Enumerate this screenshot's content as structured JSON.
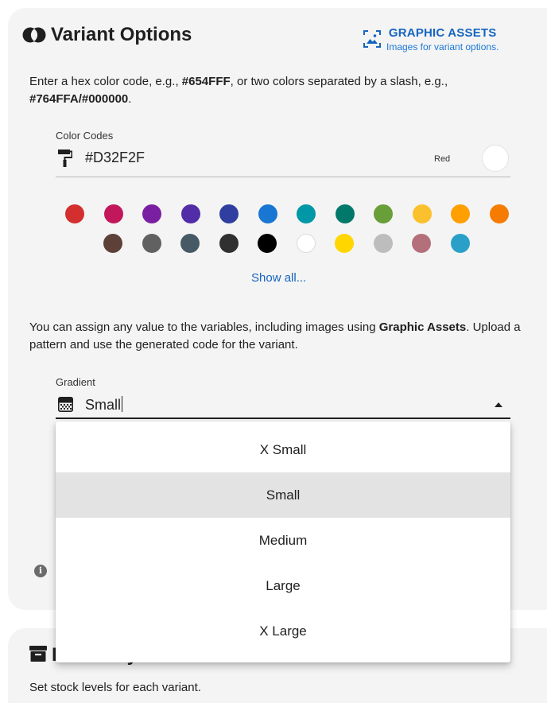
{
  "variant_options": {
    "title": "Variant Options",
    "graphic_assets": {
      "title": "GRAPHIC ASSETS",
      "subtitle": "Images for variant options."
    },
    "intro": {
      "prefix": "Enter a hex color code, e.g., ",
      "example1": "#654FFF",
      "middle": ", or two colors separated by a slash, e.g., ",
      "example2": "#764FFA/#000000",
      "suffix": "."
    },
    "color_codes": {
      "label": "Color Codes",
      "value": "#D32F2F",
      "color_name": "Red",
      "preview_color": "#ffffff"
    },
    "swatches_row1": [
      "#d32f2f",
      "#c2185b",
      "#7b1fa2",
      "#512da8",
      "#303f9f",
      "#1976d2",
      "#0097a7",
      "#00796b",
      "#689f38",
      "#fbc02d",
      "#ffa000",
      "#f57c00"
    ],
    "swatches_row2": [
      "#5d4037",
      "#616161",
      "#455a64",
      "#303030",
      "#000000",
      "#ffffff",
      "#ffd600",
      "#bdbdbd",
      "#b4707a",
      "#2aa0c8"
    ],
    "show_all": "Show all...",
    "paragraph2": {
      "prefix": "You can assign any value to the variables, including images using ",
      "bold": "Graphic Assets",
      "suffix": ". Upload a pattern and use the generated code for the variant."
    },
    "gradient": {
      "label": "Gradient",
      "value": "Small",
      "options": [
        "X Small",
        "Small",
        "Medium",
        "Large",
        "X Large"
      ],
      "selected_index": 1
    }
  },
  "inventory": {
    "title": "Inventory",
    "subtitle": "Set stock levels for each variant."
  }
}
